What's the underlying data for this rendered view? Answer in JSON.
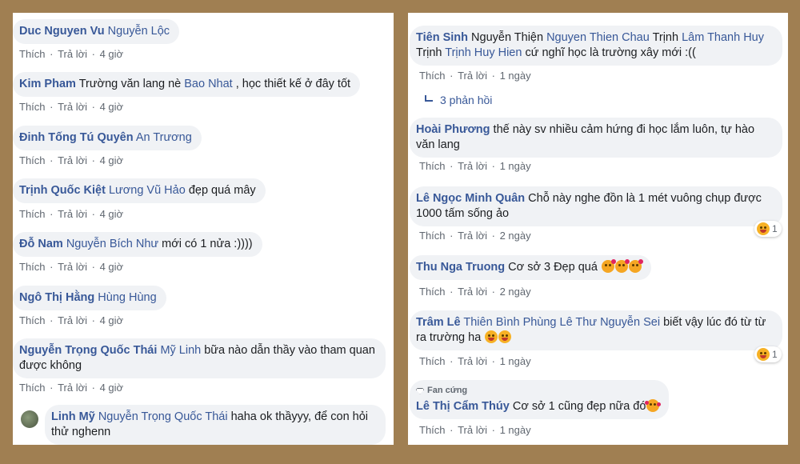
{
  "left": [
    {
      "author": "Duc Nguyen Vu",
      "mentions": [
        "Nguyễn Lộc"
      ],
      "text": "",
      "like": "Thích",
      "reply": "Trả lời",
      "time": "4 giờ"
    },
    {
      "author": "Kim Pham",
      "pre": "Trường văn lang nè ",
      "mentions": [
        "Bao Nhat"
      ],
      "text": " , học thiết kế ở đây tốt",
      "like": "Thích",
      "reply": "Trả lời",
      "time": "4 giờ"
    },
    {
      "author": "Đinh Tống Tú Quyên",
      "mentions": [
        "An Trương"
      ],
      "text": "",
      "like": "Thích",
      "reply": "Trả lời",
      "time": "4 giờ"
    },
    {
      "author": "Trịnh Quốc Kiệt",
      "mentions": [
        "Lương Vũ Hảo"
      ],
      "text": " đẹp quá mây",
      "like": "Thích",
      "reply": "Trả lời",
      "time": "4 giờ"
    },
    {
      "author": "Đỗ Nam",
      "mentions": [
        "Nguyễn Bích Như"
      ],
      "text": " mới có 1 nửa :))))",
      "like": "Thích",
      "reply": "Trả lời",
      "time": "4 giờ"
    },
    {
      "author": "Ngô Thị Hằng",
      "mentions": [
        "Hùng Hùng"
      ],
      "text": "",
      "like": "Thích",
      "reply": "Trả lời",
      "time": "4 giờ"
    },
    {
      "author": "Nguyễn Trọng Quốc Thái",
      "mentions": [
        "Mỹ Linh"
      ],
      "text": " bữa nào dẫn thầy vào tham quan",
      "text2": "được không",
      "like": "Thích",
      "reply": "Trả lời",
      "time": "4 giờ"
    },
    {
      "author": "Linh Mỹ",
      "mentions": [
        "Nguyễn Trọng Quốc Thái"
      ],
      "text": " haha ok thầyyy, để con hỏi",
      "text2": "thử nghenn"
    }
  ],
  "right": [
    {
      "author": "Tiên Sinh",
      "line1": [
        {
          "t": " Nguyễn Thiện ",
          "m": false
        },
        {
          "t": "Nguyen Thien Chau",
          "m": true
        },
        {
          "t": " Trịnh ",
          "m": false
        },
        {
          "t": "Lâm Thanh Huy",
          "m": true
        }
      ],
      "line2": [
        {
          "t": "Trịnh ",
          "m": false
        },
        {
          "t": "Trịnh Huy Hien",
          "m": true
        },
        {
          "t": " cứ nghĩ học là trường xây mới :((",
          "m": false
        }
      ],
      "like": "Thích",
      "reply": "Trả lời",
      "time": "1 ngày",
      "replies": "3 phản hồi"
    },
    {
      "author": "Hoài Phương",
      "text": " thế này sv nhiều cảm hứng đi học lắm luôn, tự hào",
      "text2": "văn lang",
      "like": "Thích",
      "reply": "Trả lời",
      "time": "1 ngày"
    },
    {
      "author": "Lê Ngọc Minh Quân",
      "text": " Chỗ này nghe đồn là 1 mét vuông chụp được",
      "text2": "1000 tấm sống ảo",
      "like": "Thích",
      "reply": "Trả lời",
      "time": "2 ngày",
      "react_count": "1"
    },
    {
      "author": "Thu Nga Truong",
      "text": " Cơ sở 3 Đẹp quá ",
      "like": "Thích",
      "reply": "Trả lời",
      "time": "2 ngày"
    },
    {
      "author": "Trâm Lê",
      "mentions": [
        "Thiên Bình",
        "Phùng Lê Thư",
        "Nguyễn Sei"
      ],
      "text": " biết vậy lúc đó từ từ",
      "text2": "ra trường ha ",
      "like": "Thích",
      "reply": "Trả lời",
      "time": "1 ngày",
      "react_count": "1"
    },
    {
      "badge": "Fan cứng",
      "author": "Lê Thị Cẩm Thúy",
      "text": " Cơ sở 1 cũng đẹp nữa đó",
      "like": "Thích",
      "reply": "Trả lời",
      "time": "1 ngày"
    }
  ]
}
